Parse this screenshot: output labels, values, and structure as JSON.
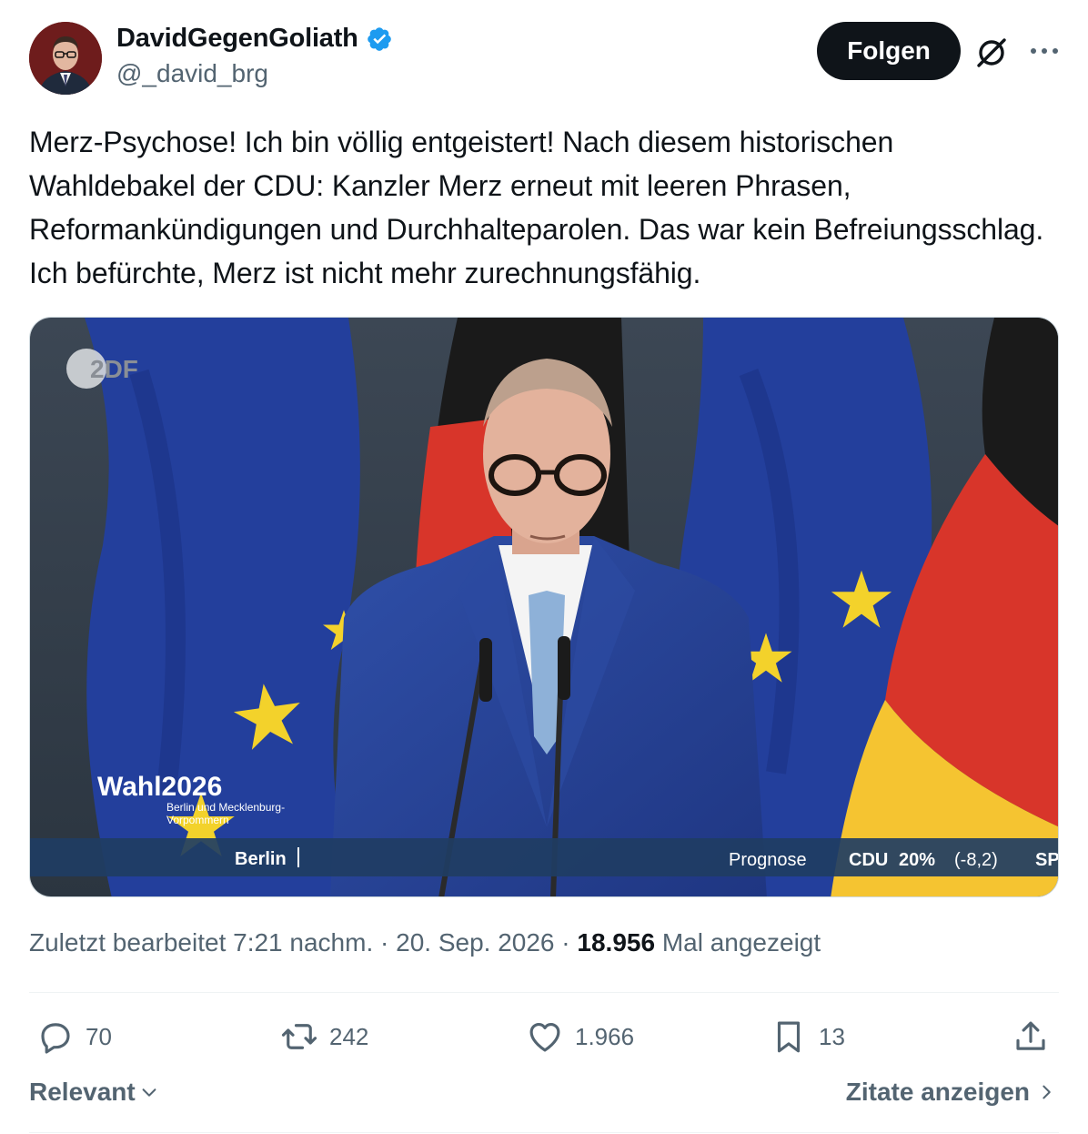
{
  "author": {
    "display_name": "DavidGegenGoliath",
    "handle": "@_david_brg",
    "verified": true
  },
  "header": {
    "follow_label": "Folgen",
    "grok_icon": "grok-icon",
    "more_icon": "more-icon"
  },
  "tweet": {
    "text": "Merz-Psychose! Ich bin völlig entgeistert! Nach diesem historischen Wahldebakel der CDU: Kanzler Merz erneut mit leeren Phrasen, Reformankündigungen und Durchhalteparolen. Das war kein Befreiungsschlag. Ich befürchte, Merz ist nicht mehr zurechnungsfähig."
  },
  "media": {
    "logo": "2DF",
    "overlay_title": "Wahl2026",
    "overlay_subtitle_line1": "Berlin und Mecklenburg-",
    "overlay_subtitle_line2": "Vorpommern",
    "ticker_location": "Berlin",
    "ticker_label": "Prognose",
    "ticker_party": "CDU",
    "ticker_value": "20%",
    "ticker_change": "(-8,2)",
    "ticker_next": "SP"
  },
  "meta": {
    "edited_label": "Zuletzt bearbeitet",
    "time": "7:21 nachm.",
    "separator": "·",
    "date": "20. Sep. 2026",
    "views_count": "18.956",
    "views_label": "Mal angezeigt"
  },
  "actions": {
    "replies": "70",
    "reposts": "242",
    "likes": "1.966",
    "bookmarks": "13"
  },
  "footer": {
    "sort_label": "Relevant",
    "quotes_label": "Zitate anzeigen"
  },
  "colors": {
    "verified": "#1d9bf0",
    "follow_bg": "#0f1419",
    "secondary_text": "#536471",
    "eu_blue": "#233f9c",
    "de_red": "#d8352a",
    "de_gold": "#f5c431"
  }
}
